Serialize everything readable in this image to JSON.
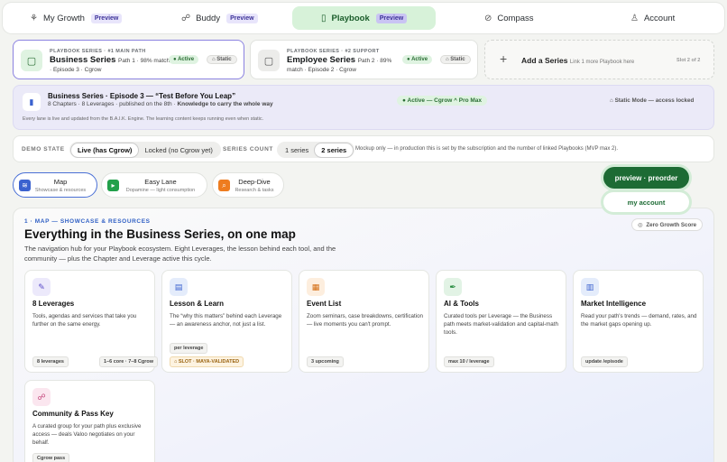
{
  "nav": {
    "tabs": [
      {
        "label": "My Growth",
        "badge": "Preview",
        "icon": "sprout-icon"
      },
      {
        "label": "Buddy",
        "badge": "Preview",
        "icon": "people-icon"
      },
      {
        "label": "Playbook",
        "badge": "Preview",
        "icon": "book-icon",
        "active": true
      },
      {
        "label": "Compass",
        "icon": "compass-icon"
      },
      {
        "label": "Account",
        "icon": "person-icon"
      }
    ]
  },
  "series": [
    {
      "kicker": "PLAYBOOK SERIES · #1 MAIN PATH",
      "title": "Business Series",
      "sub": "Path 1 · 98% match",
      "line2": "· Episode 3 · Cgrow",
      "active": "Active",
      "static": "Static"
    },
    {
      "kicker": "PLAYBOOK SERIES · #2 SUPPORT",
      "title": "Employee Series",
      "sub": "Path 2 · 89%",
      "line2": "match · Episode 2 · Cgrow",
      "active": "Active",
      "static": "Static"
    }
  ],
  "add_series": {
    "label": "Add a Series",
    "hint": "Link 1 more Playbook here",
    "slot": "Slot 2 of 2"
  },
  "banner": {
    "title": "Business Series · Episode 3 — “Test Before You Leap”",
    "sub_prefix": "8 Chapters · 8 Leverages · published on the 8th · ",
    "sub_bold": "Knowledge to carry the whole way",
    "status": "Active — Cgrow ^ Pro Max",
    "static_mode": "Static Mode — access locked",
    "note": "Every lane is live and updated from the B.A.I.K. Engine. The learning content keeps running even when static."
  },
  "demo": {
    "state_label": "DEMO STATE",
    "state_options": [
      "Live (has Cgrow)",
      "Locked (no Cgrow yet)"
    ],
    "count_label": "SERIES COUNT",
    "count_options": [
      "1 series",
      "2 series"
    ],
    "note": "Mockup only — in production this is set by the subscription and the number of linked Playbooks (MVP max 2)."
  },
  "lanes": [
    {
      "title": "Map",
      "sub": "Showcase & resources",
      "color": "#3b62cf"
    },
    {
      "title": "Easy Lane",
      "sub": "Dopamine — light consumption",
      "color": "#22a04a"
    },
    {
      "title": "Deep-Dive",
      "sub": "Research & tasks",
      "color": "#ee7c1f"
    }
  ],
  "actions": {
    "preorder": "preview · preorder",
    "account": "my account"
  },
  "main": {
    "kicker": "1 · MAP — SHOWCASE & RESOURCES",
    "title": "Everything in the Business Series, on one map",
    "lead": "The navigation hub for your Playbook ecosystem. Eight Leverages, the lesson behind each tool, and the community — plus the Chapter and Leverage active this cycle.",
    "zgs": "Zero Growth Score"
  },
  "cards": [
    {
      "title": "8 Leverages",
      "desc": "Tools, agendas and services that take you further on the same energy.",
      "chips": [
        "8 leverages",
        "1–6 core · 7–8 Cgrow"
      ],
      "icon_bg": "#ece9fb",
      "icon_fg": "#5a4bc8"
    },
    {
      "title": "Lesson & Learn",
      "desc": "The “why this matters” behind each Leverage — an awareness anchor, not just a list.",
      "chips": [
        "per leverage"
      ],
      "chip_warn": "SLOT · MAYA-VALIDATED",
      "icon_bg": "#e4ecfb",
      "icon_fg": "#3b62cf"
    },
    {
      "title": "Event List",
      "desc": "Zoom seminars, case breakdowns, certification — live moments you can't prompt.",
      "chips": [
        "3 upcoming"
      ],
      "icon_bg": "#fdeede",
      "icon_fg": "#d36b10"
    },
    {
      "title": "AI & Tools",
      "desc": "Curated tools per Leverage — the Business path meets market-validation and capital-math tools.",
      "chips": [
        "max 10 / leverage"
      ],
      "icon_bg": "#e2f3e5",
      "icon_fg": "#268a3e"
    },
    {
      "title": "Market Intelligence",
      "desc": "Read your path's trends — demand, rates, and the market gaps opening up.",
      "chips": [
        "update /episode"
      ],
      "icon_bg": "#e4ecfb",
      "icon_fg": "#3b62cf"
    },
    {
      "title": "Community & Pass Key",
      "desc": "A curated group for your path plus exclusive access — deals Valoo negotiates on your behalf.",
      "chips": [
        "Cgrow pass"
      ],
      "icon_bg": "#fbe6ef",
      "icon_fg": "#c23d76"
    }
  ]
}
